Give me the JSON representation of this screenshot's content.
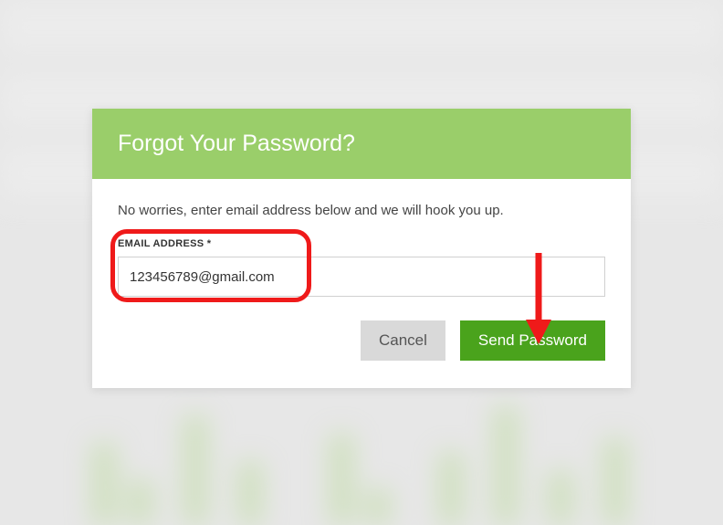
{
  "modal": {
    "title": "Forgot Your Password?",
    "subtitle": "No worries, enter email address below and we will hook you up.",
    "email_label": "EMAIL ADDRESS *",
    "email_value": "123456789@gmail.com",
    "cancel_label": "Cancel",
    "send_label": "Send Password"
  },
  "colors": {
    "header_bg": "#9ace6a",
    "send_bg": "#4aa31c",
    "highlight": "#ef1a1a"
  }
}
